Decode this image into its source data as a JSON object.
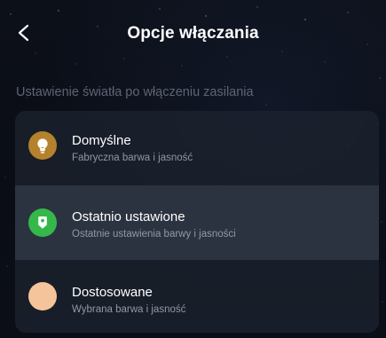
{
  "header": {
    "title": "Opcje włączania",
    "back_icon": "chevron-left-icon"
  },
  "section": {
    "label": "Ustawienie światła po włączeniu zasilania"
  },
  "options": [
    {
      "title": "Domyślne",
      "subtitle": "Fabryczna barwa i jasność",
      "icon": "lightbulb-icon",
      "icon_color": "#b4812d",
      "selected": false
    },
    {
      "title": "Ostatnio ustawione",
      "subtitle": "Ostatnie ustawienia barwy i jasności",
      "icon": "bookmark-icon",
      "icon_color": "#35b84a",
      "selected": true
    },
    {
      "title": "Dostosowane",
      "subtitle": "Wybrana barwa i jasność",
      "icon": "color-swatch-icon",
      "icon_color": "#f6c49a",
      "selected": false
    }
  ]
}
